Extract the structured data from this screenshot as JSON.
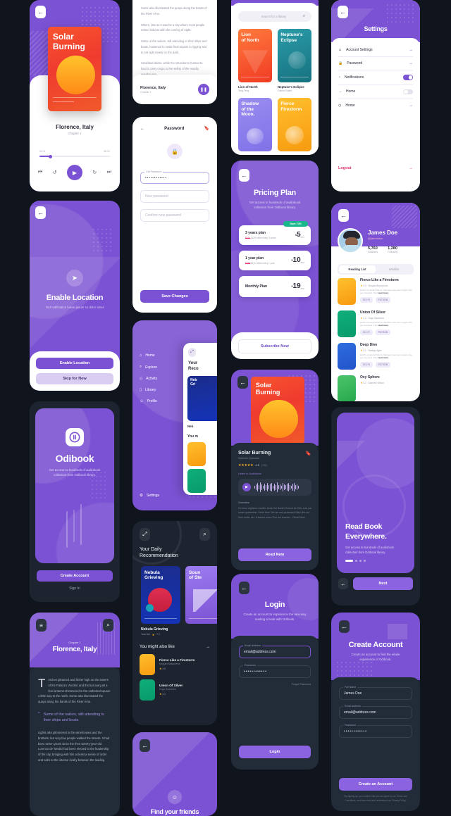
{
  "meta": {
    "kit_name": "Odibook",
    "background": "#10141c",
    "accent": "#7b52d3"
  },
  "screens": {
    "player": {
      "name": "Audio Player",
      "back_icon": "arrow-left-icon",
      "cover_title": "Solar\nBurning",
      "cover_line1": "Solar",
      "cover_line2": "Burning",
      "book_title": "Florence, Italy",
      "chapter": "Chapter 1",
      "time_current": "00:11",
      "time_total": "08:31",
      "controls": [
        "previous-icon",
        "rewind-15-icon",
        "play-icon",
        "forward-15-icon",
        "next-icon"
      ]
    },
    "reader_top": {
      "name": "Reader",
      "paragraphs": [
        "Some also illuminated the quays along the banks of the River Arno.",
        "Where, late as it was for a city where most people retired indoors with the coming of night.",
        "Some of the sailors, still attending to their ships and boats, hastened to make final repairs to rigging and to set right nearly on the dark.",
        "Scrubbed decks, while the stevedores hurried to haul in carry cargo to the safety of the nearby warehouses."
      ],
      "footer_title": "Florence, Italy",
      "footer_chapter": "Chapter 1",
      "footer_button_icon": "pause-icon"
    },
    "password": {
      "name": "Password",
      "title": "Password",
      "back_icon": "arrow-left-icon",
      "bookmark_icon": "bookmark-icon",
      "lock_icon": "lock-icon",
      "fields": [
        {
          "label": "Old Password",
          "value": "••••••••••••",
          "placeholder": "Old Password",
          "filled": true
        },
        {
          "label": "",
          "value": "",
          "placeholder": "New password",
          "filled": false
        },
        {
          "label": "",
          "value": "",
          "placeholder": "Confirm new password",
          "filled": false
        }
      ],
      "save_label": "Save Changes"
    },
    "menu": {
      "name": "Side Menu",
      "items": [
        {
          "label": "Home",
          "icon": "home-icon"
        },
        {
          "label": "Explore",
          "icon": "search-icon"
        },
        {
          "label": "Activity",
          "icon": "activity-icon"
        },
        {
          "label": "Library",
          "icon": "library-icon"
        },
        {
          "label": "Profile",
          "icon": "person-icon"
        }
      ],
      "settings_label": "Settings",
      "settings_icon": "gear-icon",
      "peek_title_line1": "Your",
      "peek_title_line2": "Reco"
    },
    "home": {
      "name": "Home / Daily Recommendation",
      "menu_icon": "expand-icon",
      "search_icon": "search-icon",
      "title_line1": "Your Daily",
      "title_line2": "Recommendation",
      "featured": [
        {
          "title": "Nebula Grieving",
          "cover_line1": "Nebula",
          "cover_line2": "Grieving",
          "author": "Yara Bal",
          "rating": "7.2"
        },
        {
          "title": "Sound of Steel",
          "cover_line1": "Soun",
          "cover_line2": "of Ste",
          "author": "",
          "rating": ""
        }
      ],
      "section_title": "You might also like",
      "section_arrow_icon": "arrow-right-icon",
      "list": [
        {
          "title": "Fierce Like a Firestorm",
          "author": "Morgan Beauchene",
          "rating": "4.9"
        },
        {
          "title": "Union Of Silver",
          "author": "Hugo Saavedra",
          "rating": "4.4"
        }
      ]
    },
    "library": {
      "name": "Library",
      "search_placeholder": "Search for a library",
      "search_icon": "search-icon",
      "books": [
        {
          "cover_line1": "Lion",
          "cover_line2": "of North",
          "title": "Lion of North",
          "author": "Teng Teng"
        },
        {
          "cover_line1": "Neptune's",
          "cover_line2": "Eclipse",
          "title": "Neptune's Eclipse",
          "author": "Gabriel Butler"
        },
        {
          "cover_line1": "Shadow",
          "cover_line2": "of the",
          "cover_line3": "Moon.",
          "title": "Shadow of the Moon",
          "author": ""
        },
        {
          "cover_line1": "Fierce",
          "cover_line2": "Firestorm",
          "title": "Fierce Firestorm",
          "author": ""
        }
      ]
    },
    "pricing": {
      "name": "Pricing Plan",
      "back_icon": "arrow-left-icon",
      "title": "Pricing Plan",
      "subtitle": "Get access to hundreds of audiobook collection from Odibook library.",
      "badge": "Save 74%",
      "plans": [
        {
          "name": "3 years plan",
          "note_strike": "$164",
          "note": "$180 billed every 3 years",
          "currency": "$",
          "price": "5",
          "per": "/mo",
          "highlight": true
        },
        {
          "name": "1 year plan",
          "note_strike": "$228",
          "note": "$120 billed every 1 year",
          "currency": "$",
          "price": "10",
          "per": "/mo",
          "highlight": false
        },
        {
          "name": "Monthly Plan",
          "note_strike": "",
          "note": "",
          "currency": "$",
          "price": "19",
          "per": "/mo",
          "highlight": false
        }
      ],
      "cta": "Subscribe Now"
    },
    "book_detail": {
      "name": "Book Detail",
      "back_icon": "arrow-left-icon",
      "cover_line1": "Solar",
      "cover_line2": "Burning",
      "title": "Solar Burning",
      "author": "Schecter Quezada",
      "bookmark_icon": "bookmark-icon",
      "rating": "4.5",
      "reviews": "(789)",
      "listen_label": "Listen to Audiobook",
      "play_icon": "play-icon",
      "overview_label": "Overview",
      "overview": "It's been eighteen months since the Baxter School for Girls was put under quarantine. Since then Tao hid and protected Kitty's life out from under her. It started when Tom the teacher... Read More",
      "read_more": "Read More",
      "cta": "Read Now"
    },
    "login": {
      "name": "Login",
      "back_icon": "arrow-left-icon",
      "title": "Login",
      "subtitle": "Create an account to experience the new way reading a book with Odibook.",
      "fields": [
        {
          "label": "Email Address",
          "value": "email@address.com"
        },
        {
          "label": "Password",
          "value": "••••••••••••"
        }
      ],
      "forgot": "Forgot Password",
      "cta": "Login"
    },
    "settings": {
      "name": "Settings",
      "back_icon": "arrow-left-icon",
      "title": "Settings",
      "items": [
        {
          "label": "Account Settings",
          "icon": "person-icon",
          "control": "arrow"
        },
        {
          "label": "Password",
          "icon": "lock-icon",
          "control": "arrow"
        },
        {
          "label": "Notifications",
          "icon": "bell-icon",
          "control": "toggle-on"
        },
        {
          "label": "Home",
          "icon": "arrow-right-icon",
          "control": "toggle-off"
        },
        {
          "label": "Home",
          "icon": "clock-icon",
          "control": "arrow"
        }
      ],
      "logout": "Logout",
      "logout_color": "#e0306b"
    },
    "profile": {
      "name": "Profile",
      "back_icon": "arrow-left-icon",
      "user_name": "James Doe",
      "user_handle": "@jamesdoe",
      "stats": [
        {
          "value": "5,760",
          "label": "Followers"
        },
        {
          "value": "1,280",
          "label": "Following"
        }
      ],
      "tabs": [
        {
          "label": "Reading List",
          "active": true
        },
        {
          "label": "Wishlist",
          "active": false
        }
      ],
      "books": [
        {
          "title": "Fierce Like a Firestorm",
          "rating": "4.9",
          "author": "Morgan Beauchene",
          "desc": "Earth's peaceful bitters chateaux wax ares vegan else get dousand. Part",
          "read_more": "read more",
          "tags": [
            "SCI FI",
            "FICTION"
          ]
        },
        {
          "title": "Union Of Silver",
          "rating": "4.4",
          "author": "Hugo Saavedra",
          "desc": "Earth's peaceful bitters chateaux wax ares vegan else get dousand. Part",
          "read_more": "read more",
          "tags": [
            "SCI FI",
            "FICTION"
          ]
        },
        {
          "title": "Deep Dive",
          "rating": "4.1",
          "author": "Rodrigo Agile",
          "desc": "Earth's peaceful bitters chateaux wax ares vegan else get dousand. Part",
          "read_more": "read more",
          "tags": [
            "SCI FI",
            "FICTION"
          ]
        },
        {
          "title": "Oxy Sphere",
          "rating": "4.2",
          "author": "Jasmine Wilson",
          "desc": "",
          "read_more": "",
          "tags": []
        }
      ]
    },
    "onboarding": {
      "name": "Onboarding",
      "title_line1": "Read Book",
      "title_line2": "Everywhere.",
      "subtitle": "Get access to hundreds of audiobook collection from Odibook library.",
      "back_icon": "arrow-left-icon",
      "cta": "Next",
      "dots": 4,
      "active_dot": 0
    },
    "location": {
      "name": "Enable Location",
      "back_icon": "arrow-left-icon",
      "pin_icon": "location-icon",
      "title": "Enable Location",
      "subtitle": "Get notification lorem ipsum so dolor amet",
      "primary_cta": "Enable Location",
      "secondary_cta": "Skip for Now"
    },
    "splash": {
      "name": "Splash / Welcome",
      "logo_icon": "odibook-logo-icon",
      "title": "Odibook",
      "subtitle": "Get access to hundreds of audiobook collection from Odibook library.",
      "primary_cta": "Create Account",
      "secondary_cta": "Sign In"
    },
    "chapter": {
      "name": "Chapter Reader",
      "settings_icon": "text-settings-icon",
      "search_icon": "search-icon",
      "chapter_label": "Chapter 1",
      "title": "Florence, Italy",
      "dropcap": "T",
      "paragraph1": "orches gleamed and flicker high on the towers of the Palazzo Vecchio and the bar and just a few lanterns shimmered in the cathedral square a little way to the north. Some also illuminated the quays along the banks of the River Arno.",
      "quote_icon": "quote-icon",
      "quote": "Some of the sailors, still attending to their ships and boats",
      "paragraph2": "Lights also glimmered in the winehouses and the brothels, but very few people walked the streets. It had been seven years since the then twenty-year-old Lorenzo de' Medici had been elected to the leadership of the city, bringing with him at least a sense of order and calm to the intense rivalry between the leading"
    },
    "create_account": {
      "name": "Create Account",
      "back_icon": "arrow-left-icon",
      "title": "Create Account",
      "subtitle": "Create an account to feel the whole experience of Odibook.",
      "fields": [
        {
          "label": "Full Name",
          "value": "James Doe"
        },
        {
          "label": "Email Address",
          "value": "email@address.com"
        },
        {
          "label": "Password",
          "value": "••••••••••••"
        }
      ],
      "cta": "Create an Account",
      "terms": "By signing up, you confirm that you are agree to our Terms and Conditions, and have read and understood our Privacy Policy."
    },
    "friends": {
      "name": "Find Friends",
      "back_icon": "arrow-left-icon",
      "person_icon": "person-add-icon",
      "title": "Find your friends"
    }
  }
}
